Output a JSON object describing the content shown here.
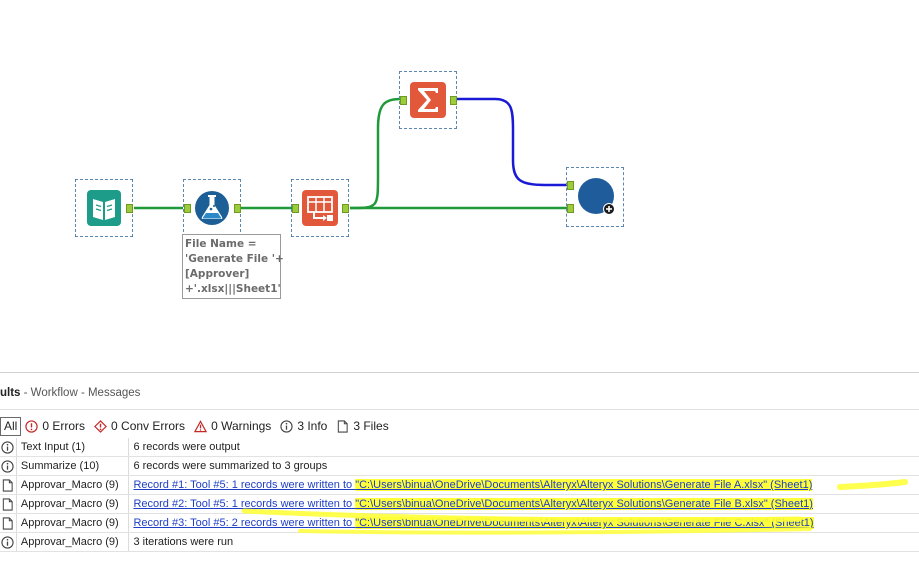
{
  "canvas": {
    "annotation": {
      "lines": [
        "File Name =",
        "'Generate File '+",
        "[Approver]",
        "+'.xlsx|||Sheet1'"
      ]
    },
    "tools": [
      {
        "name": "Text Input",
        "icon": "book-icon"
      },
      {
        "name": "Approvar_Macro",
        "icon": "flask-icon"
      },
      {
        "name": "Select/Transform",
        "icon": "table-arrow-icon"
      },
      {
        "name": "Summarize",
        "icon": "sigma-icon"
      },
      {
        "name": "Macro Output",
        "icon": "blue-circle-icon"
      }
    ],
    "colors": {
      "connection": "#1f9a3a",
      "blue_connection": "#1a1ad6",
      "accent": "#e2583a",
      "teal": "#1e9c8a"
    }
  },
  "results": {
    "title_prefix": "ults",
    "title_sub": " - Workflow - Messages",
    "filters": {
      "all": "All",
      "errors": "0 Errors",
      "conv_errors": "0 Conv Errors",
      "warnings": "0 Warnings",
      "info": "3 Info",
      "files": "3 Files"
    },
    "rows": [
      {
        "type": "info",
        "tool": "Text Input (1)",
        "msg": "6 records were output"
      },
      {
        "type": "info",
        "tool": "Summarize (10)",
        "msg": "6 records were summarized to 3 groups"
      },
      {
        "type": "file",
        "tool": "Approvar_Macro (9)",
        "msg_pre": "Record #1: Tool #5: 1 records were written to ",
        "msg_path": "\"C:\\Users\\binua\\OneDrive\\Documents\\Alteryx\\Alteryx Solutions\\Generate File A.xlsx\" (Sheet1)"
      },
      {
        "type": "file",
        "tool": "Approvar_Macro (9)",
        "msg_pre": "Record #2: Tool #5: 1 records were written to ",
        "msg_path": "\"C:\\Users\\binua\\OneDrive\\Documents\\Alteryx\\Alteryx Solutions\\Generate File B.xlsx\" (Sheet1)"
      },
      {
        "type": "file",
        "tool": "Approvar_Macro (9)",
        "msg_pre": "Record #3: Tool #5: 2 records were written to ",
        "msg_path": "\"C:\\Users\\binua\\OneDrive\\Documents\\Alteryx\\Alteryx Solutions\\Generate File C.xlsx\" (Sheet1)"
      },
      {
        "type": "info",
        "tool": "Approvar_Macro (9)",
        "msg": "3 iterations were run"
      }
    ]
  }
}
